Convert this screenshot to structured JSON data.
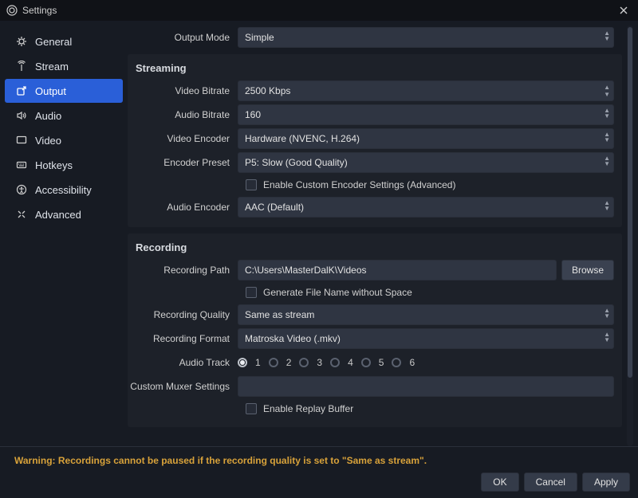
{
  "window": {
    "title": "Settings"
  },
  "sidebar": {
    "items": [
      {
        "label": "General"
      },
      {
        "label": "Stream"
      },
      {
        "label": "Output"
      },
      {
        "label": "Audio"
      },
      {
        "label": "Video"
      },
      {
        "label": "Hotkeys"
      },
      {
        "label": "Accessibility"
      },
      {
        "label": "Advanced"
      }
    ]
  },
  "output_mode": {
    "label": "Output Mode",
    "value": "Simple"
  },
  "streaming": {
    "title": "Streaming",
    "video_bitrate": {
      "label": "Video Bitrate",
      "value": "2500 Kbps"
    },
    "audio_bitrate": {
      "label": "Audio Bitrate",
      "value": "160"
    },
    "video_encoder": {
      "label": "Video Encoder",
      "value": "Hardware (NVENC, H.264)"
    },
    "encoder_preset": {
      "label": "Encoder Preset",
      "value": "P5: Slow (Good Quality)"
    },
    "enable_custom": {
      "label": "Enable Custom Encoder Settings (Advanced)"
    },
    "audio_encoder": {
      "label": "Audio Encoder",
      "value": "AAC (Default)"
    }
  },
  "recording": {
    "title": "Recording",
    "path": {
      "label": "Recording Path",
      "value": "C:\\Users\\MasterDalK\\Videos",
      "browse": "Browse"
    },
    "gen_no_space": {
      "label": "Generate File Name without Space"
    },
    "quality": {
      "label": "Recording Quality",
      "value": "Same as stream"
    },
    "format": {
      "label": "Recording Format",
      "value": "Matroska Video (.mkv)"
    },
    "audio_track": {
      "label": "Audio Track",
      "tracks": [
        "1",
        "2",
        "3",
        "4",
        "5",
        "6"
      ]
    },
    "muxer": {
      "label": "Custom Muxer Settings",
      "value": ""
    },
    "replay_buffer": {
      "label": "Enable Replay Buffer"
    }
  },
  "warning": "Warning: Recordings cannot be paused if the recording quality is set to \"Same as stream\".",
  "footer": {
    "ok": "OK",
    "cancel": "Cancel",
    "apply": "Apply"
  }
}
